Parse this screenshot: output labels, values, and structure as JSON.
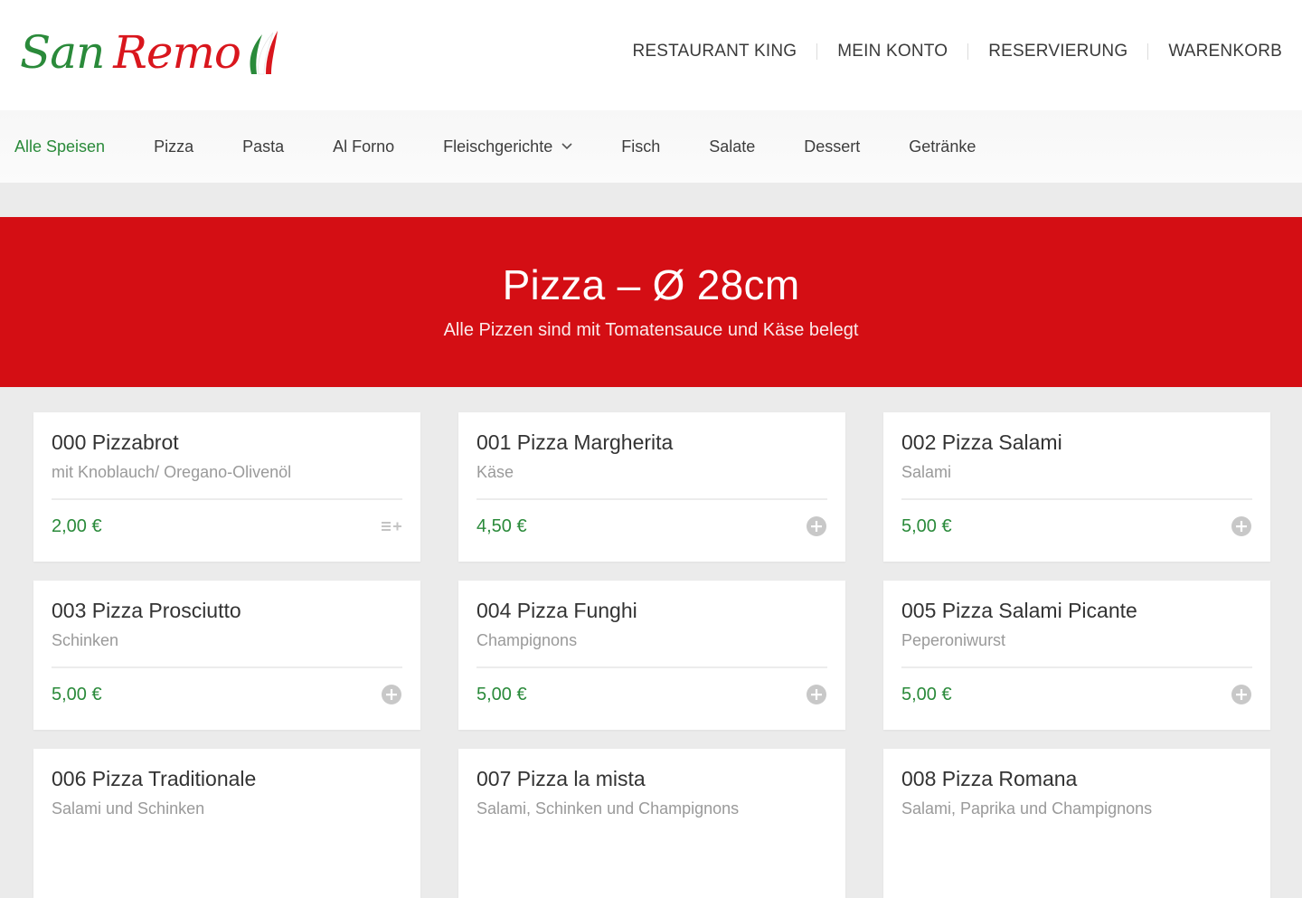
{
  "brand": {
    "logo_part1": "San",
    "logo_part2": "Remo",
    "green": "#2a8a3a",
    "red": "#d9161d"
  },
  "top_nav": [
    {
      "label": "RESTAURANT KING"
    },
    {
      "label": "MEIN KONTO"
    },
    {
      "label": "RESERVIERUNG"
    },
    {
      "label": "WARENKORB"
    }
  ],
  "categories": [
    {
      "label": "Alle Speisen",
      "active": true
    },
    {
      "label": "Pizza"
    },
    {
      "label": "Pasta"
    },
    {
      "label": "Al Forno"
    },
    {
      "label": "Fleischgerichte",
      "dropdown": true
    },
    {
      "label": "Fisch"
    },
    {
      "label": "Salate"
    },
    {
      "label": "Dessert"
    },
    {
      "label": "Getränke"
    }
  ],
  "hero": {
    "title": "Pizza – Ø 28cm",
    "subtitle": "Alle Pizzen sind mit Tomatensauce und Käse belegt",
    "background": "#d40e14"
  },
  "menu_items": [
    {
      "name": "000 Pizzabrot",
      "desc": "mit Knoblauch/ Oregano-Olivenöl",
      "price": "2,00 €",
      "icon": "list-add-icon"
    },
    {
      "name": "001 Pizza Margherita",
      "desc": "Käse",
      "price": "4,50 €",
      "icon": "plus-circle-icon"
    },
    {
      "name": "002 Pizza Salami",
      "desc": "Salami",
      "price": "5,00 €",
      "icon": "plus-circle-icon"
    },
    {
      "name": "003 Pizza Prosciutto",
      "desc": "Schinken",
      "price": "5,00 €",
      "icon": "plus-circle-icon"
    },
    {
      "name": "004 Pizza Funghi",
      "desc": "Champignons",
      "price": "5,00 €",
      "icon": "plus-circle-icon"
    },
    {
      "name": "005 Pizza Salami Picante",
      "desc": "Peperoniwurst",
      "price": "5,00 €",
      "icon": "plus-circle-icon"
    },
    {
      "name": "006 Pizza Traditionale",
      "desc": "Salami und Schinken",
      "price": "",
      "icon": ""
    },
    {
      "name": "007 Pizza la mista",
      "desc": "Salami, Schinken und Champignons",
      "price": "",
      "icon": ""
    },
    {
      "name": "008 Pizza Romana",
      "desc": "Salami, Paprika und Champignons",
      "price": "",
      "icon": ""
    }
  ]
}
